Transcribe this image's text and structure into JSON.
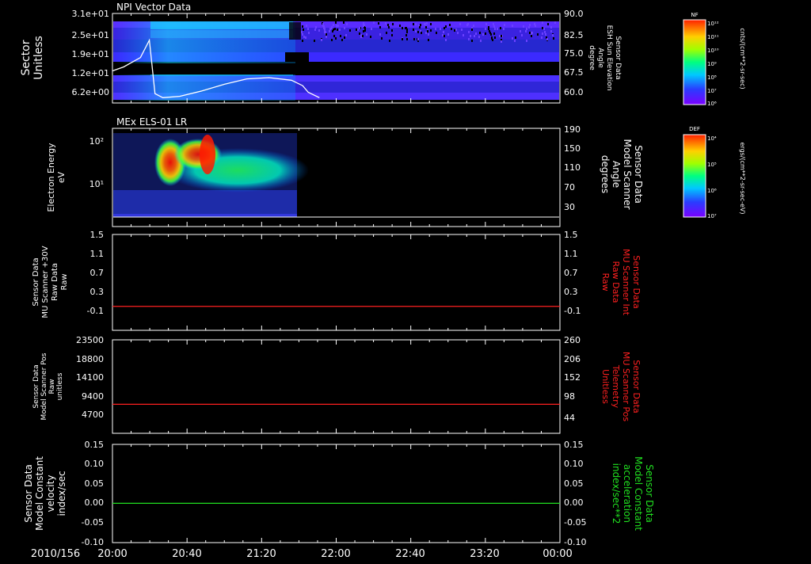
{
  "date_label": "2010/156",
  "time_axis": {
    "ticks": [
      "20:00",
      "20:40",
      "21:20",
      "22:00",
      "22:40",
      "23:20",
      "00:00"
    ],
    "start_hour": 20,
    "end_hour": 24
  },
  "panels": {
    "npi": {
      "title": "NPI Vector Data",
      "left_label": [
        "Sector",
        "Unitless"
      ],
      "left_ticks": [
        "3.1e+01",
        "2.5e+01",
        "1.9e+01",
        "1.2e+01",
        "6.2e+00"
      ],
      "right_label": [
        "Sensor Data",
        "ESH Sun Elevation",
        "Angle",
        "degree"
      ],
      "right_ticks": [
        "90.0",
        "82.5",
        "75.0",
        "67.5",
        "60.0"
      ],
      "colorbar": {
        "label": "NF",
        "ticks": [
          "10¹²",
          "10¹¹",
          "10¹⁰",
          "10⁹",
          "10⁸",
          "10⁷",
          "10⁶"
        ],
        "unit": "cnts/(cm**2-sr-sec)"
      }
    },
    "els": {
      "title": "MEx ELS-01 LR",
      "left_label": [
        "Electron Energy",
        "eV"
      ],
      "left_ticks": [
        "10²",
        "10¹"
      ],
      "right_label": [
        "Sensor Data",
        "Model Scanner",
        "Angle",
        "degrees"
      ],
      "right_ticks": [
        "190",
        "150",
        "110",
        "70",
        "30"
      ],
      "colorbar": {
        "label": "DEF",
        "ticks": [
          "10⁴",
          "10⁵",
          "10⁶",
          "10⁷"
        ],
        "unit": "ergs/(cm**2-sr-sec-eV)"
      }
    },
    "mu_raw": {
      "left_label": [
        "Sensor Data",
        "MU Scanner +30V",
        "Raw Data",
        "Raw"
      ],
      "left_ticks": [
        "1.5",
        "1.1",
        "0.7",
        "0.3",
        "-0.1"
      ],
      "right_label": [
        "Sensor Data",
        "MU Scanner Int",
        "Raw Data",
        "Raw"
      ],
      "right_ticks": [
        "1.5",
        "1.1",
        "0.7",
        "0.3",
        "-0.1"
      ]
    },
    "scanner_pos": {
      "left_label": [
        "Sensor Data",
        "Model Scanner Pos",
        "Raw",
        "unitless"
      ],
      "left_ticks": [
        "23500",
        "18800",
        "14100",
        "9400",
        "4700"
      ],
      "right_label": [
        "Sensor Data",
        "MU Scanner Pos",
        "Telemetry",
        "Unitless"
      ],
      "right_ticks": [
        "260",
        "206",
        "152",
        "98",
        "44"
      ]
    },
    "constant": {
      "left_label": [
        "Sensor Data",
        "Model Constant",
        "velocity",
        "index/sec"
      ],
      "left_ticks": [
        "0.15",
        "0.10",
        "0.05",
        "0.00",
        "-0.05",
        "-0.10"
      ],
      "right_label": [
        "Sensor Data",
        "Model Constant",
        "acceleration",
        "index/sec**2"
      ],
      "right_ticks": [
        "0.15",
        "0.10",
        "0.05",
        "0.00",
        "-0.05",
        "-0.10"
      ]
    }
  },
  "colors": {
    "red_line": "#ff2020",
    "green_line": "#20e020",
    "white_curve": "#ffffff"
  },
  "chart_data": [
    {
      "type": "line",
      "panel": "npi",
      "series": [
        {
          "x": [
            20.0,
            20.1,
            20.25,
            20.33,
            20.38,
            20.45,
            20.6,
            20.8,
            21.0,
            21.2,
            21.4,
            21.6,
            21.7,
            21.75,
            21.85
          ],
          "y": [
            68.5,
            70,
            73.5,
            80,
            60,
            58.5,
            59,
            61,
            63.5,
            65.5,
            66,
            65,
            63,
            60.5,
            58.5
          ]
        }
      ],
      "ylim": [
        56.5,
        90
      ]
    },
    {
      "type": "heatmap",
      "panel": "els",
      "series": [
        {
          "x": [
            20.0,
            21.8
          ],
          "y": [
            20,
            20
          ]
        }
      ],
      "ylim": [
        5,
        190
      ]
    },
    {
      "type": "line",
      "panel": "mu_raw",
      "series": [
        {
          "x": [
            20,
            24
          ],
          "y": [
            0.0,
            0.0
          ]
        }
      ],
      "ylim": [
        -0.5,
        1.5
      ]
    },
    {
      "type": "line",
      "panel": "scanner_pos",
      "series": [
        {
          "x": [
            20,
            24
          ],
          "y": [
            7300,
            7300
          ]
        }
      ],
      "ylim": [
        0,
        23500
      ]
    },
    {
      "type": "line",
      "panel": "constant",
      "series": [
        {
          "x": [
            20,
            24
          ],
          "y": [
            0.0,
            0.0
          ]
        }
      ],
      "ylim": [
        -0.1,
        0.15
      ]
    }
  ]
}
